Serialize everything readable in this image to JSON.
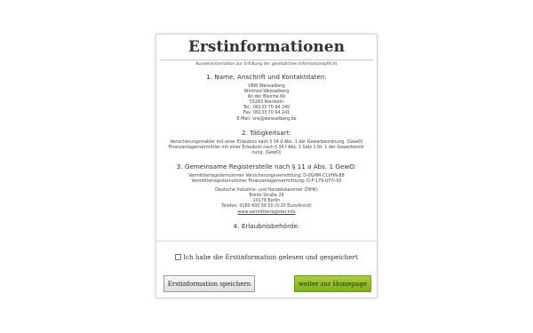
{
  "dialog": {
    "title": "Erstinformationen",
    "intro": "Kundeninformation zur Erfüllung der gesetzlichen Informationspflicht",
    "section1": {
      "heading": "1. Name, Anschrift und Kontaktdaten:",
      "lines": [
        "VRW Weisselberg",
        "Winfried Weisselberg",
        "An der Bleiche 6b",
        "55283 Nierstein",
        "Tel.: 06133 70 94 240",
        "Fax: 06133 70 94 241",
        "E-Mail: vrw@weisselberg.de"
      ]
    },
    "section2": {
      "heading": "2. Tätigkeitsart:",
      "lines": [
        "Versicherungsmakler mit einer Erlaubnis nach § 34 d Abs. 1 der Gewerbeordnung. (GewO)",
        "Finanzanlagenvermittler mit einer Erlaubnis nach § 34 f Abs. 1 Satz 1 Nr. 1 der Gewerbeord-",
        "nung. (GewO)"
      ]
    },
    "section3": {
      "heading": "3. Gemeinsame Registerstelle nach § 11 a Abs. 1 GewO:",
      "register_lines": [
        "Vermittlerregisternummer Versicherungsvermittlung: D-0GHM-C1VHN-88",
        "Vermittlerregisternummer Finanzanlagenvermittlung: D-F-179-UYYI-00"
      ],
      "address_lines": [
        "Deutsche Industrie- und Handelskammer (DIHK)",
        "Breite Straße 29",
        "10178 Berlin",
        "Telefon: 0180 600 58 50 (0,20 Euro/Anruf)"
      ],
      "link": "www.vermittlerregister.info"
    },
    "section4": {
      "heading": "4. Erlaubnisbehörde:"
    },
    "consent_label": "Ich habe die Erstinformation gelesen und gespeichert",
    "consent_checked": false,
    "save_button": "Erstinformation speichern",
    "home_button": "weiter zur Homepage"
  },
  "colors": {
    "accent_button": "#8fbd2c",
    "dialog_border": "#d6d6d6"
  }
}
